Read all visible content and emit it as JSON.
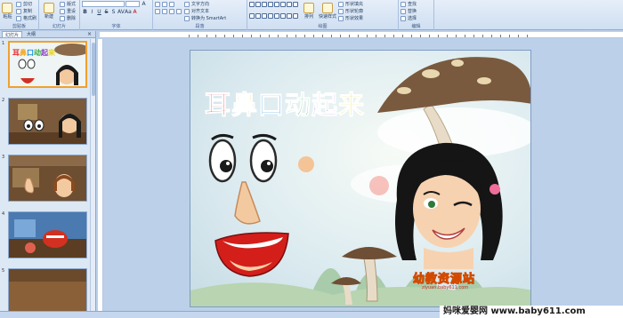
{
  "ribbon": {
    "clipboard": {
      "name": "剪贴板",
      "paste": "粘贴",
      "cut": "剪切",
      "copy": "复制",
      "format": "格式刷"
    },
    "slides": {
      "name": "幻灯片",
      "new": "新建",
      "newsub": "幻灯片",
      "layout": "版式",
      "reset": "重设",
      "delete": "删除"
    },
    "font": {
      "name": "字体",
      "family": "",
      "size": "",
      "bold": "B",
      "italic": "I",
      "underline": "U",
      "strike": "S",
      "shadow": "S",
      "spacing": "AV",
      "case": "Aa",
      "grow": "A",
      "color": "A"
    },
    "paragraph": {
      "name": "段落",
      "direction": "文字方向",
      "align": "对齐文本",
      "smartart": "转换为 SmartArt"
    },
    "drawing": {
      "name": "绘图",
      "arrange": "排列",
      "styles": "快速样式",
      "fill": "形状填充",
      "outline": "形状轮廓",
      "effects": "形状效果"
    },
    "editing": {
      "name": "编辑",
      "find": "查找",
      "replace": "替换",
      "select": "选择"
    }
  },
  "left_panel": {
    "tabs": [
      "幻灯片",
      "大纲"
    ],
    "close_icon": "close-icon",
    "thumbnails": [
      {
        "num": "1",
        "active": true
      },
      {
        "num": "2",
        "active": false
      },
      {
        "num": "3",
        "active": false
      },
      {
        "num": "4",
        "active": false
      },
      {
        "num": "5",
        "active": false
      }
    ]
  },
  "slide": {
    "title_chars": [
      "耳",
      "鼻",
      "口",
      "动",
      "起",
      "来"
    ],
    "title_colors": [
      "#e8242b",
      "#f2a81c",
      "#1a8fd8",
      "#2faa3c",
      "#8a3bc4",
      "#e8d21a"
    ],
    "logo_text": "幼教资源站",
    "logo_url": "ziyuan.baby611.com"
  },
  "watermark": "妈咪爱婴网 www.baby611.com"
}
